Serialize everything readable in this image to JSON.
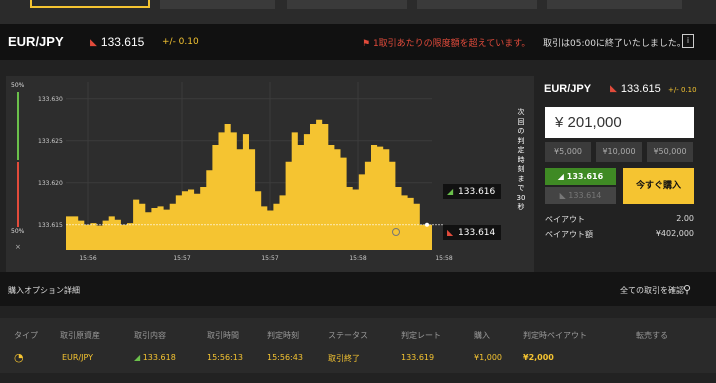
{
  "header": {
    "pair": "EUR/JPY",
    "rate": "133.615",
    "change": "+/- 0.10",
    "warning": "1取引あたりの限度額を超えています。",
    "closed_notice": "取引は05:00に終了いたしました。"
  },
  "gauge": {
    "top_pct": "50%",
    "bottom_pct": "50%",
    "close": "×",
    "up_fraction": 0.5,
    "down_fraction": 0.5
  },
  "chart": {
    "countdown_text": "次回の判定時刻まで30秒",
    "high_label": "133.616",
    "low_label": "133.614"
  },
  "chart_data": {
    "type": "area",
    "y_ticks": [
      "133.615",
      "133.620",
      "133.625",
      "133.630"
    ],
    "ylim": [
      133.612,
      133.632
    ],
    "x_ticks": [
      "15:56",
      "15:57",
      "15:57",
      "15:58",
      "15:58"
    ],
    "strike": 133.615,
    "values": [
      133.616,
      133.616,
      133.6155,
      133.615,
      133.6152,
      133.6149,
      133.6155,
      133.616,
      133.6156,
      133.615,
      133.6152,
      133.618,
      133.6175,
      133.6165,
      133.617,
      133.6172,
      133.6168,
      133.6175,
      133.6185,
      133.619,
      133.6192,
      133.6187,
      133.6195,
      133.6215,
      133.6245,
      133.626,
      133.627,
      133.626,
      133.624,
      133.6258,
      133.624,
      133.619,
      133.6172,
      133.6167,
      133.6175,
      133.6185,
      133.6225,
      133.626,
      133.6245,
      133.6258,
      133.627,
      133.6275,
      133.627,
      133.6245,
      133.624,
      133.623,
      133.6195,
      133.6192,
      133.621,
      133.6225,
      133.6245,
      133.6243,
      133.624,
      133.6225,
      133.6195,
      133.6185,
      133.6182,
      133.6175,
      133.615,
      133.615,
      133.615
    ],
    "colors": {
      "area": "#f5c431",
      "up": "#6bc04b",
      "down": "#e24b3b"
    }
  },
  "order": {
    "pair": "EUR/JPY",
    "rate": "133.615",
    "change": "+/- 0.10",
    "amount": "¥ 201,000",
    "quick": [
      "¥5,000",
      "¥10,000",
      "¥50,000"
    ],
    "high_btn": "133.616",
    "low_btn": "133.614",
    "buy_now": "今すぐ購入",
    "payout_label": "ペイアウト",
    "payout_value": "2.00",
    "payout_amt_label": "ペイアウト額",
    "payout_amt_value": "¥402,000"
  },
  "detail": {
    "title": "購入オプション詳細",
    "confirm_all": "全ての取引を確認"
  },
  "table": {
    "headers": [
      "タイプ",
      "取引原資産",
      "取引内容",
      "取引時間",
      "判定時刻",
      "ステータス",
      "判定レート",
      "購入",
      "判定時ペイアウト",
      "転売する"
    ],
    "row": {
      "asset": "EUR/JPY",
      "content": "133.618",
      "trade_time": "15:56:13",
      "judge_time": "15:56:43",
      "status": "取引終了",
      "judge_rate": "133.619",
      "purchase": "¥1,000",
      "payout": "¥2,000"
    }
  }
}
